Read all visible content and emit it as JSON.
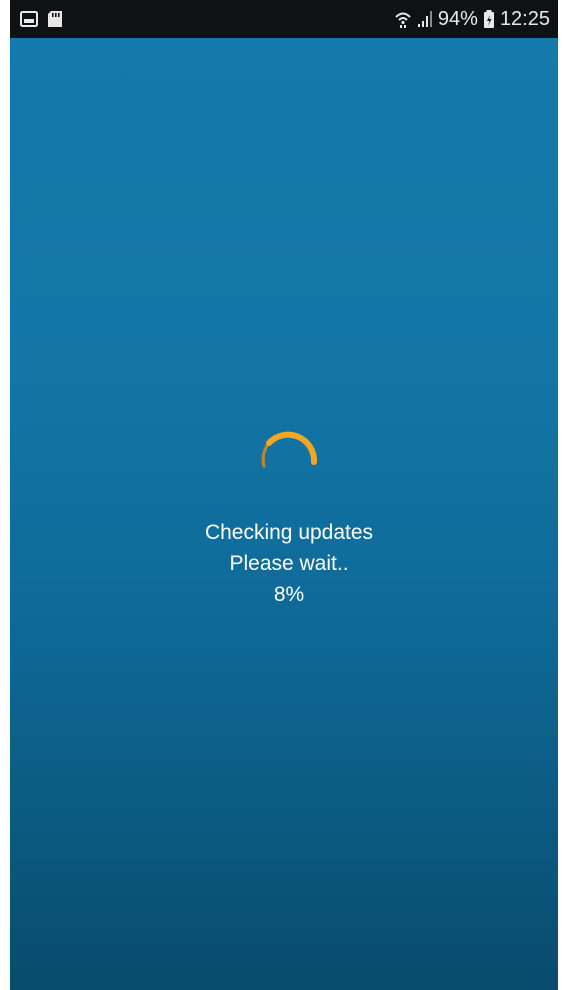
{
  "status_bar": {
    "left_icons": [
      "image-notification-icon",
      "sd-card-icon"
    ],
    "right_icons": [
      "wifi-icon",
      "signal-icon",
      "battery-icon"
    ],
    "battery_percent": "94%",
    "time": "12:25"
  },
  "loading": {
    "title": "Checking updates",
    "subtitle": "Please wait..",
    "progress_text": "8%",
    "progress_value": 0.08,
    "spinner_color": "#f5a623"
  },
  "colors": {
    "background_top": "#1479ab",
    "background_bottom": "#094b6c",
    "status_bar": "#0f1214",
    "text": "#ffffff"
  }
}
